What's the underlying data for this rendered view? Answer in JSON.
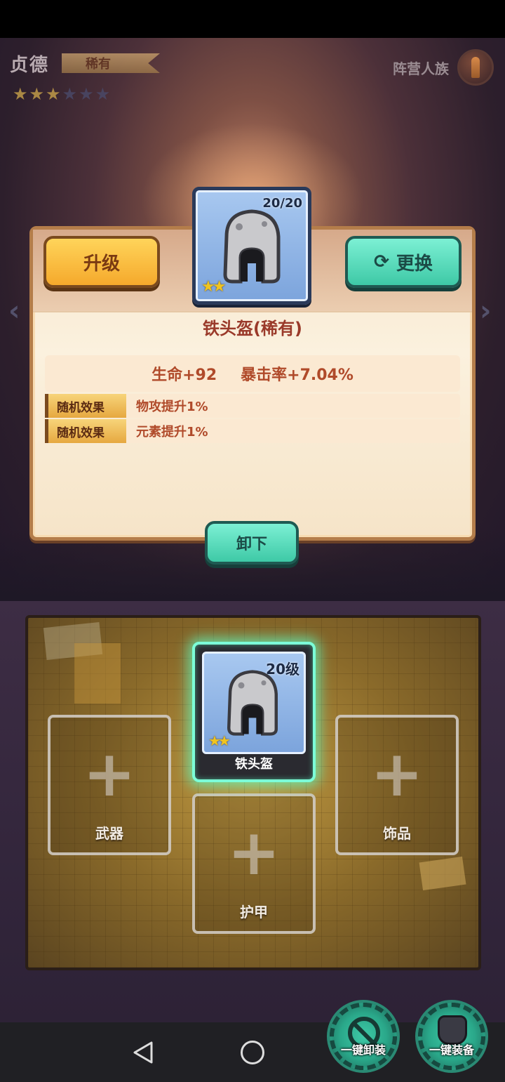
{
  "header": {
    "hero_name": "贞德",
    "rarity": "稀有",
    "stars_filled": 3,
    "stars_total": 6,
    "faction": "阵营人族"
  },
  "panel": {
    "upgrade_label": "升级",
    "replace_label": "更换",
    "item_count": "20/20",
    "item_stars": "★★",
    "item_title": "铁头盔(稀有)",
    "stats": [
      "生命+92",
      "暴击率+7.04%"
    ],
    "effects": [
      {
        "tag": "随机效果",
        "text": "物攻提升1%"
      },
      {
        "tag": "随机效果",
        "text": "元素提升1%"
      }
    ],
    "unequip_label": "卸下"
  },
  "slots": {
    "equipped": {
      "level": "20级",
      "stars": "★★",
      "name": "铁头盔"
    },
    "weapon": {
      "label": "武器",
      "plus": "+"
    },
    "accessory": {
      "label": "饰品",
      "plus": "+"
    },
    "armor": {
      "label": "护甲",
      "plus": "+"
    }
  },
  "actions": {
    "unequip_all": "一键卸装",
    "equip_all": "一键装备"
  },
  "icons": {
    "refresh": "⟳",
    "arrow_left": "‹",
    "arrow_right": "›",
    "star": "★"
  },
  "colors": {
    "accent_teal": "#3ec9a6",
    "accent_gold": "#f5a92c",
    "text_red": "#b04a2a"
  }
}
